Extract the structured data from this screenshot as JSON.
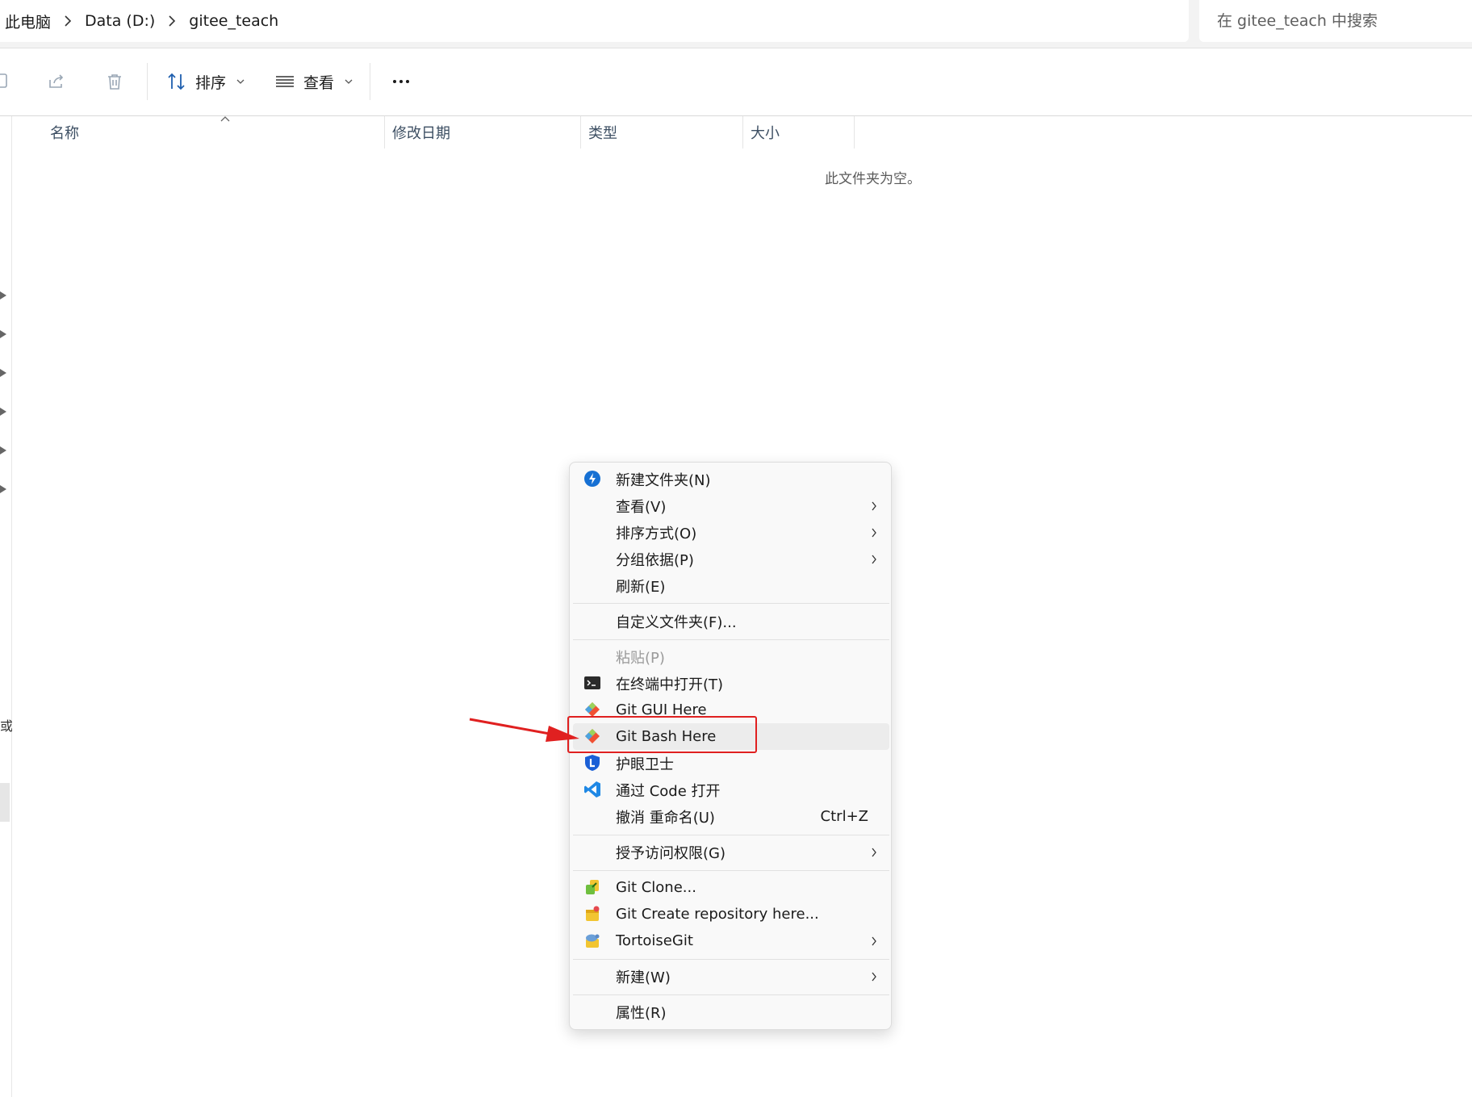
{
  "address": {
    "crumbs": [
      "此电脑",
      "Data (D:)",
      "gitee_teach"
    ]
  },
  "search": {
    "placeholder": "在 gitee_teach 中搜索"
  },
  "toolbar": {
    "sort_label": "排序",
    "view_label": "查看"
  },
  "columns": [
    "名称",
    "修改日期",
    "类型",
    "大小"
  ],
  "empty_message": "此文件夹为空。",
  "sidebar": {
    "fragment": "或"
  },
  "context_menu": {
    "items": [
      {
        "label": "新建文件夹(N)",
        "icon": "new-folder-icon"
      },
      {
        "label": "查看(V)",
        "submenu": true
      },
      {
        "label": "排序方式(O)",
        "submenu": true
      },
      {
        "label": "分组依据(P)",
        "submenu": true
      },
      {
        "label": "刷新(E)"
      },
      {
        "label": "自定义文件夹(F)..."
      },
      {
        "label": "粘贴(P)",
        "disabled": true
      },
      {
        "label": "在终端中打开(T)",
        "icon": "terminal-icon"
      },
      {
        "label": "Git GUI Here",
        "icon": "git-gui-icon"
      },
      {
        "label": "Git Bash Here",
        "icon": "git-bash-icon",
        "highlighted": true
      },
      {
        "label": "护眼卫士",
        "icon": "eye-guard-icon"
      },
      {
        "label": "通过 Code 打开",
        "icon": "vscode-icon"
      },
      {
        "label": "撤消 重命名(U)",
        "shortcut": "Ctrl+Z"
      },
      {
        "label": "授予访问权限(G)",
        "submenu": true
      },
      {
        "label": "Git Clone...",
        "icon": "git-clone-icon"
      },
      {
        "label": "Git Create repository here...",
        "icon": "git-create-repo-icon"
      },
      {
        "label": "TortoiseGit",
        "icon": "tortoisegit-icon",
        "submenu": true
      },
      {
        "label": "新建(W)",
        "submenu": true
      },
      {
        "label": "属性(R)"
      }
    ]
  },
  "colors": {
    "annotation": "#e02020",
    "git_orange": "#f05133",
    "vscode_blue": "#1f88e5",
    "header_text": "#3d4f63"
  }
}
